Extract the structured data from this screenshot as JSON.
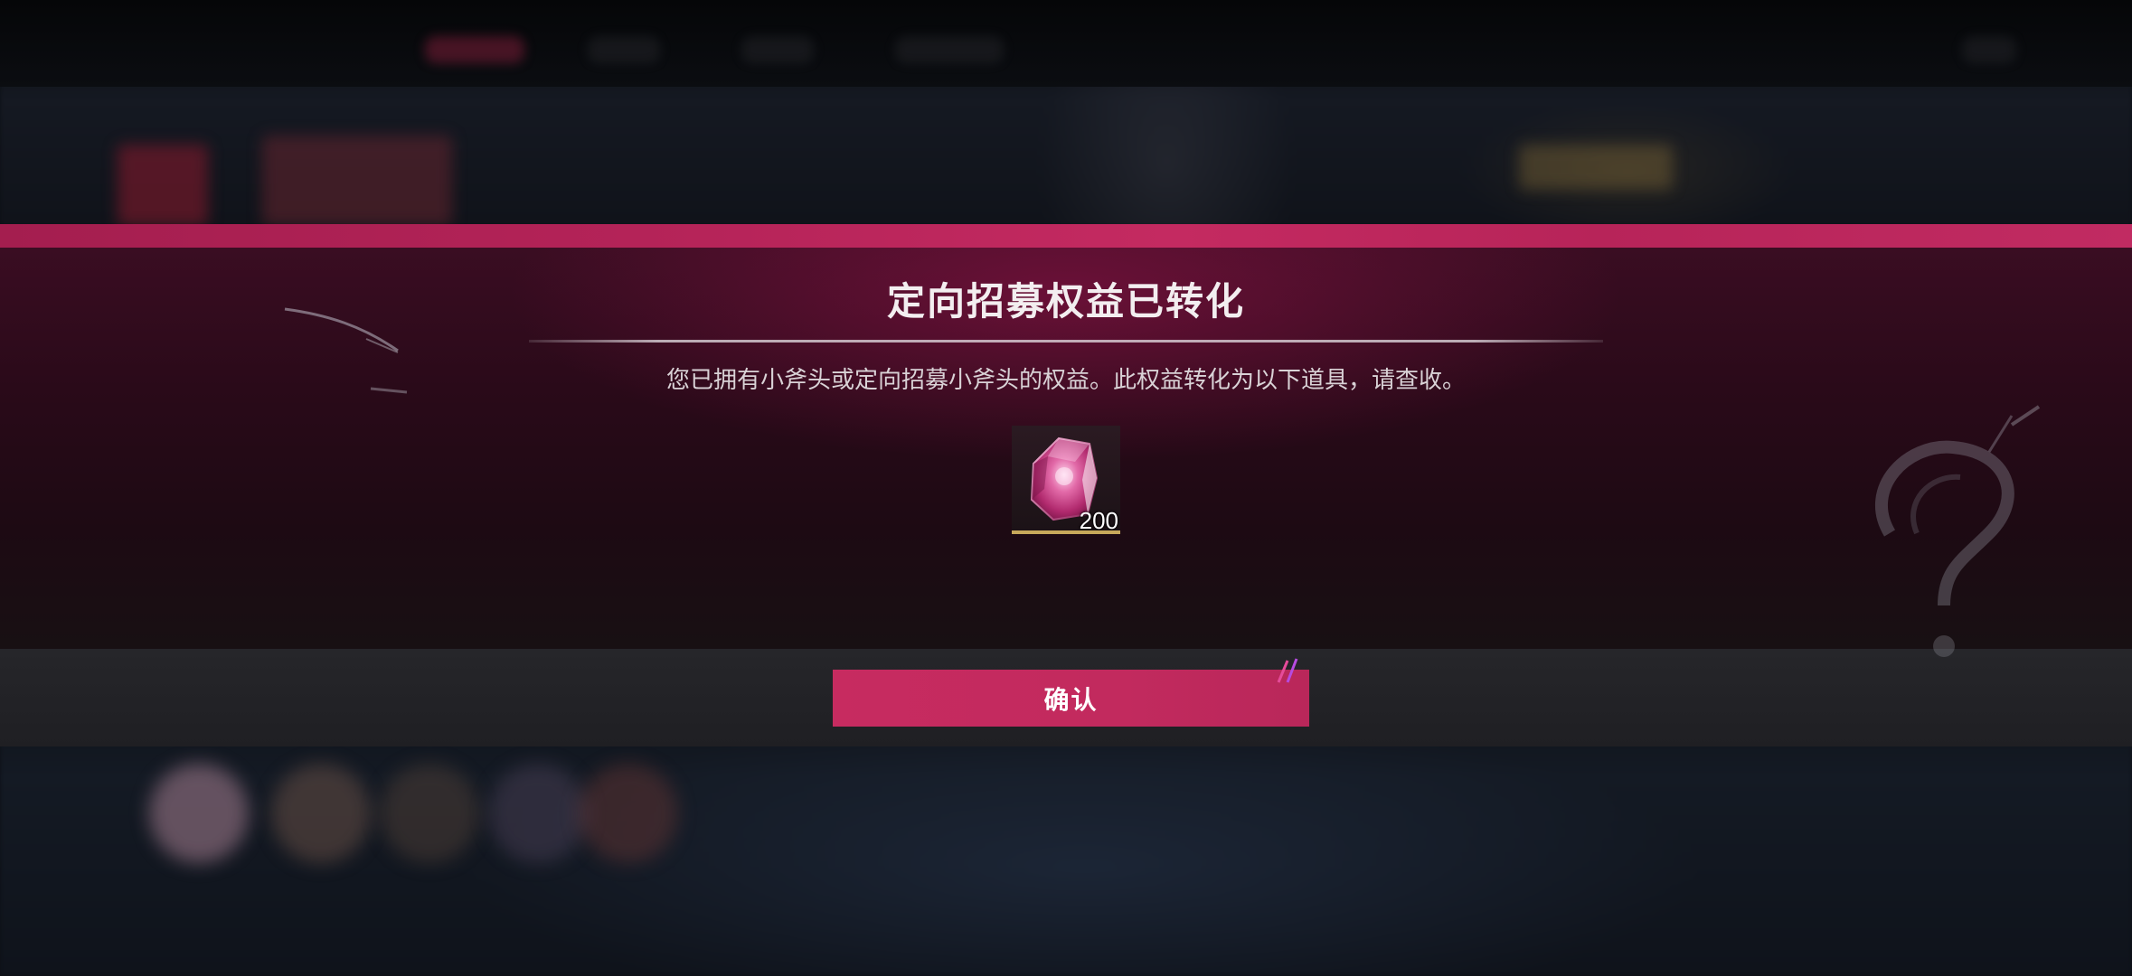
{
  "dialog": {
    "title": "定向招募权益已转化",
    "message": "您已拥有小斧头或定向招募小斧头的权益。此权益转化为以下道具，请查收。",
    "reward": {
      "icon": "pink-crystal-icon",
      "count": "200"
    },
    "confirm_label": "确认"
  },
  "colors": {
    "accent": "#c42a61",
    "dialog_background": "#2a0a19",
    "footer_background": "#242428",
    "text_primary": "#f3eef0",
    "text_secondary": "#d9d2d6",
    "rarity_bar": "#c7a85a"
  }
}
